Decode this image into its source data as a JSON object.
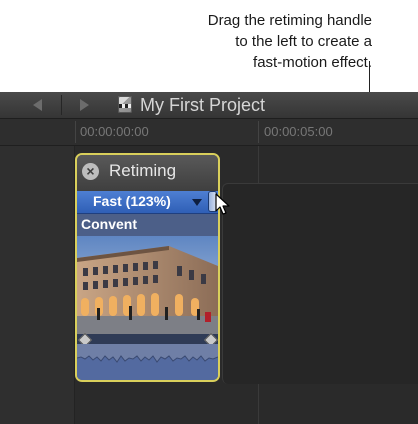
{
  "callout": {
    "line1": "Drag the retiming handle",
    "line2": "to the left to create a",
    "line3": "fast-motion effect."
  },
  "toolbar": {
    "project_title": "My First Project"
  },
  "ruler": {
    "tc_start": "00:00:00:00",
    "tc_5s": "00:00:05:00"
  },
  "retiming": {
    "title": "Retiming",
    "speed_label": "Fast (123%)"
  },
  "clip": {
    "name": "Convent"
  },
  "colors": {
    "selection_border": "#d9cf5b",
    "retime_bar": "#3e6fc5",
    "app_background": "#2b2b2b"
  }
}
